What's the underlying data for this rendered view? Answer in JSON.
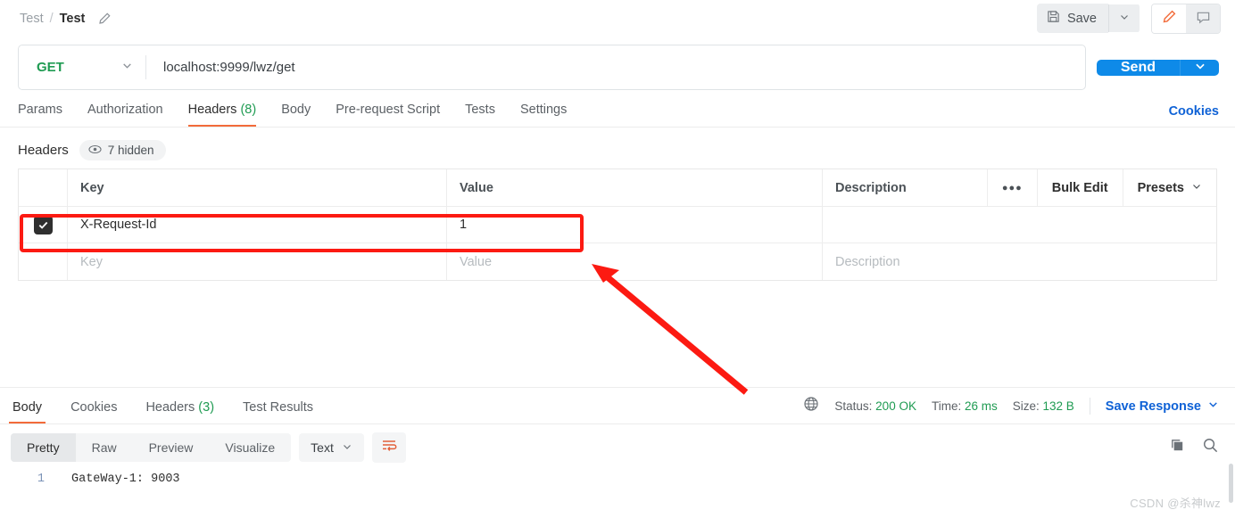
{
  "topbar": {
    "breadcrumb": {
      "parent": "Test",
      "separator": "/",
      "current": "Test"
    },
    "edit_icon": "pencil-icon",
    "save_label": "Save",
    "save_icon": "floppy-disk-icon",
    "save_caret_icon": "chevron-down-icon",
    "edit_button_icon": "pencil-icon",
    "comment_button_icon": "comment-icon"
  },
  "request": {
    "method": "GET",
    "method_caret_icon": "chevron-down-icon",
    "url": "localhost:9999/lwz/get",
    "send_label": "Send",
    "send_caret_icon": "chevron-down-icon",
    "tabs": [
      {
        "label": "Params",
        "count": "",
        "active": false
      },
      {
        "label": "Authorization",
        "count": "",
        "active": false
      },
      {
        "label": "Headers",
        "count": "(8)",
        "active": true
      },
      {
        "label": "Body",
        "count": "",
        "active": false
      },
      {
        "label": "Pre-request Script",
        "count": "",
        "active": false
      },
      {
        "label": "Tests",
        "count": "",
        "active": false
      },
      {
        "label": "Settings",
        "count": "",
        "active": false
      }
    ],
    "cookies_link": "Cookies"
  },
  "headers_section": {
    "title": "Headers",
    "hidden_pill": {
      "icon": "eye-icon",
      "label": "7 hidden"
    },
    "columns": {
      "key": "Key",
      "value": "Value",
      "description": "Description"
    },
    "actions": {
      "more_icon": "ellipsis-icon",
      "bulk_edit": "Bulk Edit",
      "presets": "Presets",
      "presets_caret_icon": "chevron-down-icon"
    },
    "rows": [
      {
        "checked": true,
        "key": "X-Request-Id",
        "value": "1",
        "description": ""
      }
    ],
    "placeholder_row": {
      "key": "Key",
      "value": "Value",
      "description": "Description"
    }
  },
  "response": {
    "tabs": [
      {
        "label": "Body",
        "count": "",
        "active": true
      },
      {
        "label": "Cookies",
        "count": "",
        "active": false
      },
      {
        "label": "Headers",
        "count": "(3)",
        "active": false
      },
      {
        "label": "Test Results",
        "count": "",
        "active": false
      }
    ],
    "globe_icon": "globe-icon",
    "status_label": "Status:",
    "status_value": "200 OK",
    "time_label": "Time:",
    "time_value": "26 ms",
    "size_label": "Size:",
    "size_value": "132 B",
    "save_response": "Save Response",
    "save_response_caret_icon": "chevron-down-icon",
    "formats": [
      {
        "label": "Pretty",
        "active": true
      },
      {
        "label": "Raw",
        "active": false
      },
      {
        "label": "Preview",
        "active": false
      },
      {
        "label": "Visualize",
        "active": false
      }
    ],
    "type_select": "Text",
    "type_caret_icon": "chevron-down-icon",
    "wrap_icon": "word-wrap-icon",
    "copy_icon": "copy-icon",
    "search_icon": "search-icon",
    "body": {
      "line_number": "1",
      "text": "GateWay-1: 9003"
    }
  },
  "annotations": {
    "highlight_color": "#fc1a12",
    "arrow_color": "#fc1a12"
  },
  "watermark": "CSDN @杀神lwz"
}
